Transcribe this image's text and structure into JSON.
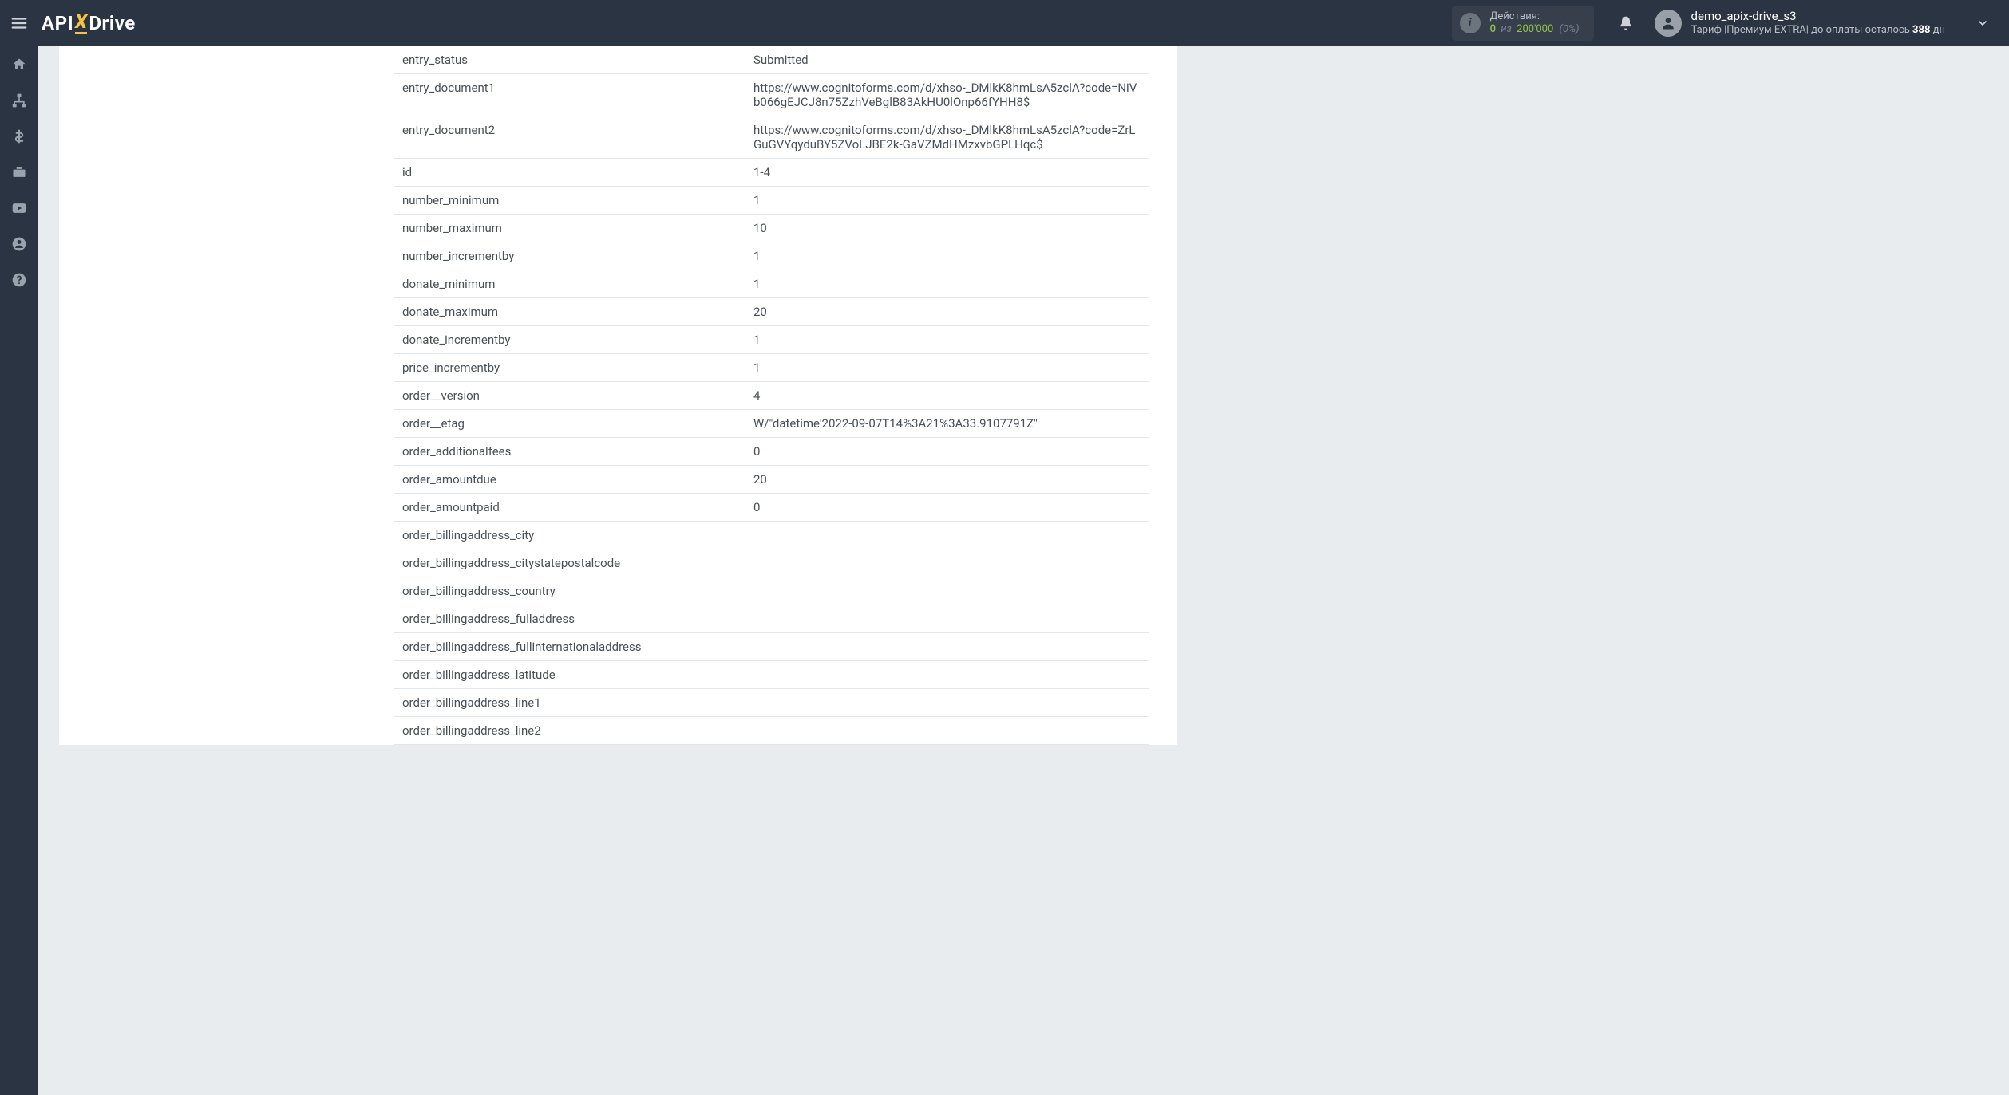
{
  "topbar": {
    "logo": {
      "api": "API",
      "x": "X",
      "drive": "Drive"
    },
    "actions": {
      "label": "Действия:",
      "count": "0",
      "iz": "из",
      "max": "200'000",
      "pct": "(0%)"
    },
    "user": {
      "name": "demo_apix-drive_s3",
      "tariff_prefix": "Тариф |Премиум EXTRA| до оплаты осталось ",
      "days": "388",
      "days_suffix": " дн"
    }
  },
  "rows": [
    {
      "key": "entry_status",
      "value": "Submitted"
    },
    {
      "key": "entry_document1",
      "value": "https://www.cognitoforms.com/d/xhso-_DMlkK8hmLsA5zclA?code=NiVb066gEJCJ8n75ZzhVeBglB83AkHU0lOnp66fYHH8$"
    },
    {
      "key": "entry_document2",
      "value": "https://www.cognitoforms.com/d/xhso-_DMlkK8hmLsA5zclA?code=ZrLGuGVYqyduBY5ZVoLJBE2k-GaVZMdHMzxvbGPLHqc$"
    },
    {
      "key": "id",
      "value": "1-4"
    },
    {
      "key": "number_minimum",
      "value": "1"
    },
    {
      "key": "number_maximum",
      "value": "10"
    },
    {
      "key": "number_incrementby",
      "value": "1"
    },
    {
      "key": "donate_minimum",
      "value": "1"
    },
    {
      "key": "donate_maximum",
      "value": "20"
    },
    {
      "key": "donate_incrementby",
      "value": "1"
    },
    {
      "key": "price_incrementby",
      "value": "1"
    },
    {
      "key": "order__version",
      "value": "4"
    },
    {
      "key": "order__etag",
      "value": "W/\"datetime'2022-09-07T14%3A21%3A33.9107791Z'\""
    },
    {
      "key": "order_additionalfees",
      "value": "0"
    },
    {
      "key": "order_amountdue",
      "value": "20"
    },
    {
      "key": "order_amountpaid",
      "value": "0"
    },
    {
      "key": "order_billingaddress_city",
      "value": ""
    },
    {
      "key": "order_billingaddress_citystatepostalcode",
      "value": ""
    },
    {
      "key": "order_billingaddress_country",
      "value": ""
    },
    {
      "key": "order_billingaddress_fulladdress",
      "value": ""
    },
    {
      "key": "order_billingaddress_fullinternationaladdress",
      "value": ""
    },
    {
      "key": "order_billingaddress_latitude",
      "value": ""
    },
    {
      "key": "order_billingaddress_line1",
      "value": ""
    },
    {
      "key": "order_billingaddress_line2",
      "value": ""
    }
  ]
}
